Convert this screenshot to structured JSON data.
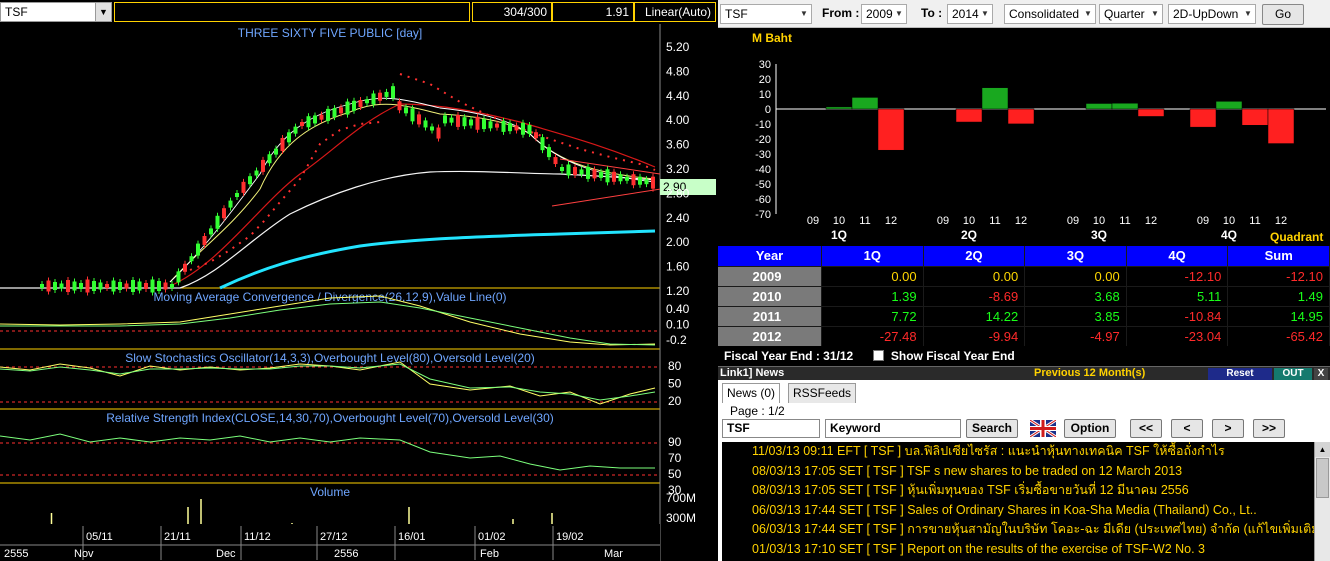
{
  "left": {
    "symbol": "TSF",
    "count": "304/300",
    "scale_value": "1.91",
    "scale_mode": "Linear(Auto)",
    "chart_title": "THREE SIXTY FIVE PUBLIC [day]",
    "price_axis": [
      "5.20",
      "4.80",
      "4.40",
      "4.00",
      "3.60",
      "3.20",
      "2.80",
      "2.40",
      "2.00",
      "1.60",
      "1.20"
    ],
    "current_price": "2.90",
    "macd_title": "Moving Average Convergence / Divergence(26,12,9),Value Line(0)",
    "macd_axis": [
      "0.40",
      "0.10",
      "-0.2"
    ],
    "stoch_title": "Slow Stochastics Oscillator(14,3,3),Overbought Level(80),Oversold Level(20)",
    "stoch_axis": [
      "80",
      "50",
      "20"
    ],
    "rsi_title": "Relative Strength Index(CLOSE,14,30,70),Overbought Level(70),Oversold Level(30)",
    "rsi_axis": [
      "90",
      "70",
      "50",
      "30"
    ],
    "vol_title": "Volume",
    "vol_axis": [
      "700M",
      "300M"
    ],
    "date_row1": [
      "05/11",
      "21/11",
      "11/12",
      "27/12",
      "16/01",
      "01/02",
      "19/02"
    ],
    "date_row2": [
      "2555",
      "Nov",
      "Dec",
      "2556",
      "Feb",
      "Mar"
    ]
  },
  "right": {
    "toolbar": {
      "symbol": "TSF",
      "from_label": "From :",
      "from_value": "2009",
      "to_label": "To :",
      "to_value": "2014",
      "statement": "Consolidated",
      "period": "Quarter",
      "view": "2D-UpDown",
      "go_label": "Go"
    },
    "chart_unit": "M Baht",
    "quadrant_label": "Quadrant",
    "colors": {
      "positive": "#19a81f",
      "negative": "#ff2020",
      "accent": "#0000ff",
      "highlight": "#ffd200"
    },
    "chart_data": {
      "type": "bar",
      "title": "",
      "ylabel": "M Baht",
      "ylim": [
        -70,
        30
      ],
      "yticks": [
        30,
        20,
        10,
        0,
        -10,
        -20,
        -30,
        -40,
        -50,
        -60,
        -70
      ],
      "groups": [
        "1Q",
        "2Q",
        "3Q",
        "4Q"
      ],
      "categories": [
        "09",
        "10",
        "11",
        "12"
      ],
      "series": [
        {
          "group": "1Q",
          "values": [
            0.0,
            1.39,
            7.72,
            -27.48
          ]
        },
        {
          "group": "2Q",
          "values": [
            0.0,
            -8.69,
            14.22,
            -9.94
          ]
        },
        {
          "group": "3Q",
          "values": [
            0.0,
            3.68,
            3.85,
            -4.97
          ]
        },
        {
          "group": "4Q",
          "values": [
            -12.1,
            5.11,
            -10.84,
            -23.04
          ]
        }
      ]
    },
    "table": {
      "headers": [
        "Year",
        "1Q",
        "2Q",
        "3Q",
        "4Q",
        "Sum"
      ],
      "rows": [
        {
          "year": "2009",
          "cells": [
            {
              "v": "0.00",
              "c": "neu"
            },
            {
              "v": "0.00",
              "c": "neu"
            },
            {
              "v": "0.00",
              "c": "neu"
            },
            {
              "v": "-12.10",
              "c": "neg"
            },
            {
              "v": "-12.10",
              "c": "neg"
            }
          ]
        },
        {
          "year": "2010",
          "cells": [
            {
              "v": "1.39",
              "c": "pos"
            },
            {
              "v": "-8.69",
              "c": "neg"
            },
            {
              "v": "3.68",
              "c": "pos"
            },
            {
              "v": "5.11",
              "c": "pos"
            },
            {
              "v": "1.49",
              "c": "pos"
            }
          ]
        },
        {
          "year": "2011",
          "cells": [
            {
              "v": "7.72",
              "c": "pos"
            },
            {
              "v": "14.22",
              "c": "pos"
            },
            {
              "v": "3.85",
              "c": "pos"
            },
            {
              "v": "-10.84",
              "c": "neg"
            },
            {
              "v": "14.95",
              "c": "pos"
            }
          ]
        },
        {
          "year": "2012",
          "cells": [
            {
              "v": "-27.48",
              "c": "neg"
            },
            {
              "v": "-9.94",
              "c": "neg"
            },
            {
              "v": "-4.97",
              "c": "neg"
            },
            {
              "v": "-23.04",
              "c": "neg"
            },
            {
              "v": "-65.42",
              "c": "neg"
            }
          ]
        }
      ]
    },
    "fiscal": {
      "label": "Fiscal  Year  End  :  31/12",
      "checkbox_label": "Show Fiscal Year End"
    },
    "news": {
      "header_label": "Link1] News",
      "previous_label": "Previous 12 Month(s)",
      "reset_label": "Reset",
      "out_label": "OUT",
      "x_label": "X",
      "tab_news": "News (0)",
      "tab_rss": "RSSFeeds",
      "page_label": "Page : 1/2",
      "symbol_value": "TSF",
      "keyword_placeholder": "Keyword",
      "search_label": "Search",
      "option_label": "Option",
      "nav_first": "<<",
      "nav_prev": "<",
      "nav_next": ">",
      "nav_last": ">>",
      "items": [
        "11/03/13 09:11  EFT  [ TSF ]  บล.ฟิลิปเซียไซรัส : แนะนำหุ้นทางเทคนิค TSF ให้ซื้อถั่งกำไร",
        "08/03/13 17:05  SET  [ TSF ]  TSF s new shares to be traded on 12 March 2013",
        "08/03/13 17:05  SET  [ TSF ]  หุ้นเพิ่มทุนของ TSF เริ่มซื้อขายวันที่ 12 มีนาคม 2556",
        "06/03/13 17:44  SET  [ TSF ]  Sales of Ordinary Shares in Koa-Sha Media (Thailand) Co., Lt..",
        "06/03/13 17:44  SET  [ TSF ]  การขายหุ้นสามัญในบริษัท โคอะ-ฉะ มีเดีย (ประเทศไทย) จำกัด (แก้ไขเพิ่มเติม)",
        "01/03/13 17:10  SET  [ TSF ]  Report on the results of the exercise of TSF-W2 No. 3"
      ]
    }
  }
}
